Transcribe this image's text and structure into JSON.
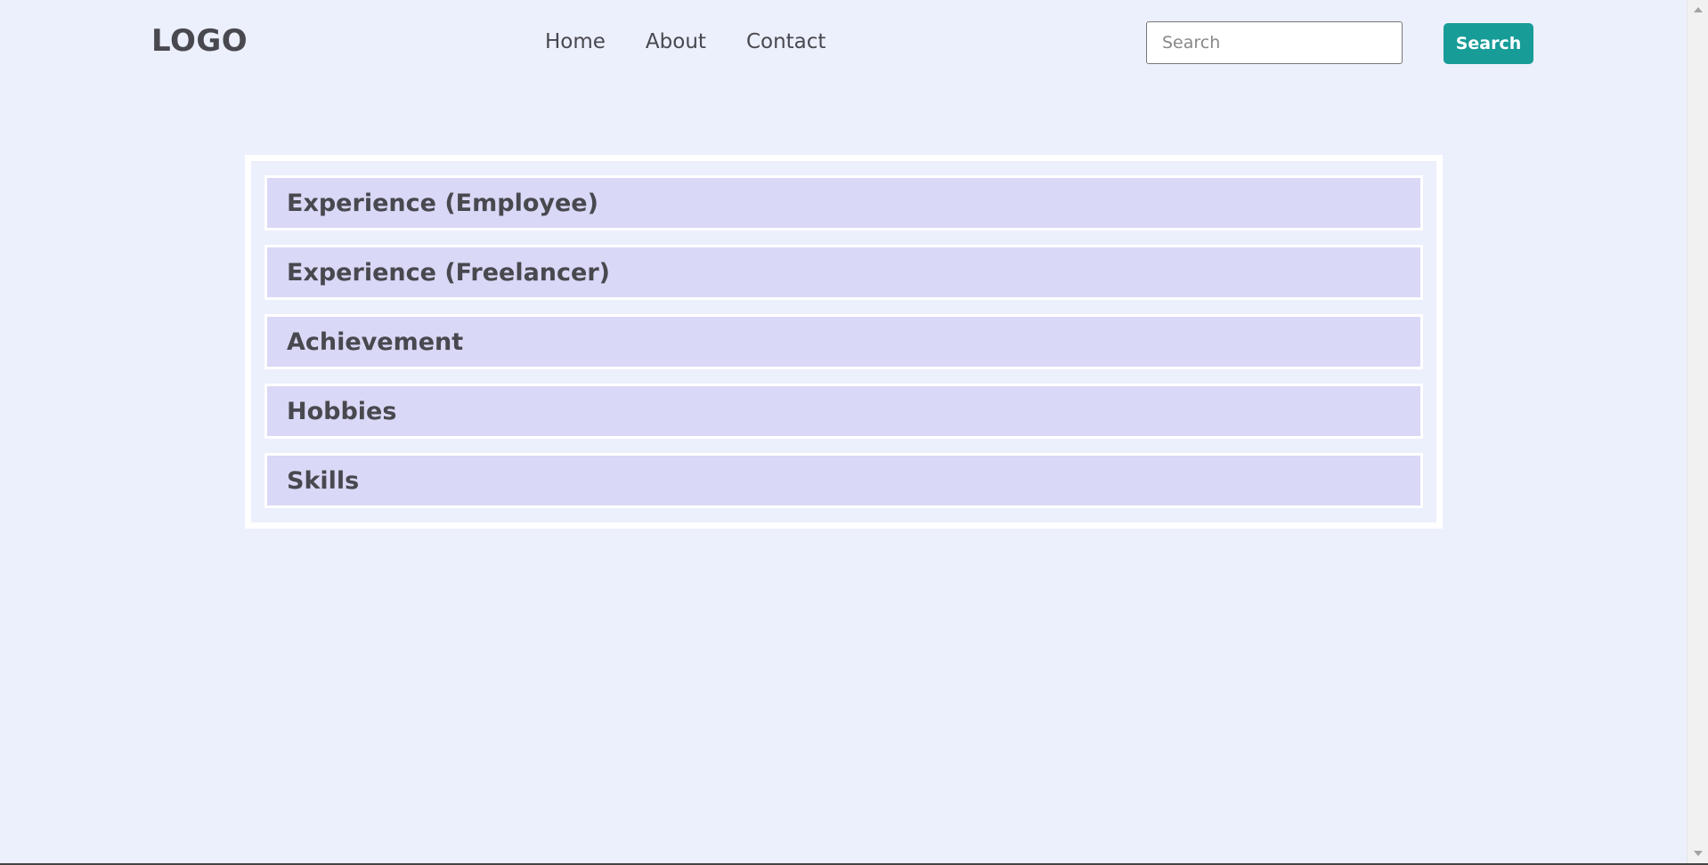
{
  "header": {
    "logo": "LOGO",
    "nav": [
      {
        "label": "Home"
      },
      {
        "label": "About"
      },
      {
        "label": "Contact"
      }
    ],
    "search": {
      "placeholder": "Search",
      "value": "",
      "button_label": "Search"
    }
  },
  "accordion": {
    "items": [
      {
        "label": "Experience (Employee)"
      },
      {
        "label": "Experience (Freelancer)"
      },
      {
        "label": "Achievement"
      },
      {
        "label": "Hobbies"
      },
      {
        "label": "Skills"
      }
    ]
  },
  "colors": {
    "background": "#eceffc",
    "accordion_item": "#d9d8f6",
    "accent_button": "#179c98",
    "text": "#48484f"
  }
}
